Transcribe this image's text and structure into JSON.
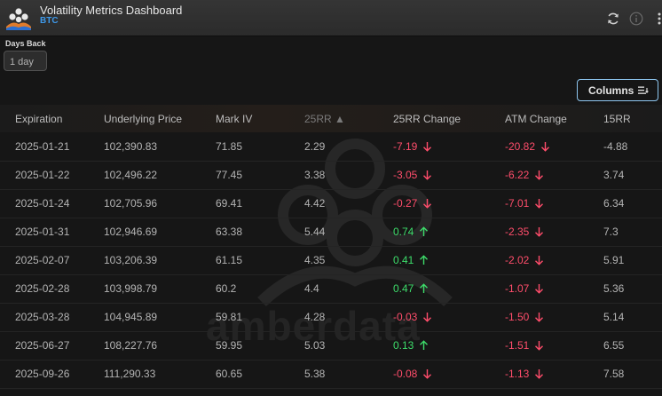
{
  "header": {
    "title": "Volatility Metrics Dashboard",
    "subtitle": "BTC",
    "icons": [
      "refresh-icon",
      "info-icon",
      "more-vertical-icon"
    ]
  },
  "controls": {
    "days_back_label": "Days Back",
    "days_back_value": "1 day",
    "columns_button_label": "Columns"
  },
  "table": {
    "sort_column": "25RR",
    "sort_direction": "ascending",
    "columns": [
      "Expiration",
      "Underlying Price",
      "Mark IV",
      "25RR",
      "25RR Change",
      "ATM Change",
      "15RR"
    ],
    "rows": [
      {
        "expiration": "2025-01-21",
        "price": "102,390.83",
        "mark_iv": "71.85",
        "rr25": "2.29",
        "rr25_change": "-7.19",
        "rr25_dir": "down",
        "atm_change": "-20.82",
        "atm_dir": "down",
        "rr15": "-4.88"
      },
      {
        "expiration": "2025-01-22",
        "price": "102,496.22",
        "mark_iv": "77.45",
        "rr25": "3.38",
        "rr25_change": "-3.05",
        "rr25_dir": "down",
        "atm_change": "-6.22",
        "atm_dir": "down",
        "rr15": "3.74"
      },
      {
        "expiration": "2025-01-24",
        "price": "102,705.96",
        "mark_iv": "69.41",
        "rr25": "4.42",
        "rr25_change": "-0.27",
        "rr25_dir": "down",
        "atm_change": "-7.01",
        "atm_dir": "down",
        "rr15": "6.34"
      },
      {
        "expiration": "2025-01-31",
        "price": "102,946.69",
        "mark_iv": "63.38",
        "rr25": "5.44",
        "rr25_change": "0.74",
        "rr25_dir": "up",
        "atm_change": "-2.35",
        "atm_dir": "down",
        "rr15": "7.3"
      },
      {
        "expiration": "2025-02-07",
        "price": "103,206.39",
        "mark_iv": "61.15",
        "rr25": "4.35",
        "rr25_change": "0.41",
        "rr25_dir": "up",
        "atm_change": "-2.02",
        "atm_dir": "down",
        "rr15": "5.91"
      },
      {
        "expiration": "2025-02-28",
        "price": "103,998.79",
        "mark_iv": "60.2",
        "rr25": "4.4",
        "rr25_change": "0.47",
        "rr25_dir": "up",
        "atm_change": "-1.07",
        "atm_dir": "down",
        "rr15": "5.36"
      },
      {
        "expiration": "2025-03-28",
        "price": "104,945.89",
        "mark_iv": "59.81",
        "rr25": "4.28",
        "rr25_change": "-0.03",
        "rr25_dir": "down",
        "atm_change": "-1.50",
        "atm_dir": "down",
        "rr15": "5.14"
      },
      {
        "expiration": "2025-06-27",
        "price": "108,227.76",
        "mark_iv": "59.95",
        "rr25": "5.03",
        "rr25_change": "0.13",
        "rr25_dir": "up",
        "atm_change": "-1.51",
        "atm_dir": "down",
        "rr15": "6.55"
      },
      {
        "expiration": "2025-09-26",
        "price": "111,290.33",
        "mark_iv": "60.65",
        "rr25": "5.38",
        "rr25_change": "-0.08",
        "rr25_dir": "down",
        "atm_change": "-1.13",
        "atm_dir": "down",
        "rr15": "7.58"
      }
    ]
  },
  "colors": {
    "negative": "#ff4d6b",
    "positive": "#3ddc6a",
    "accent": "#3e98e8",
    "button_border": "#8ec6ef"
  },
  "watermark_text": "amberdata"
}
